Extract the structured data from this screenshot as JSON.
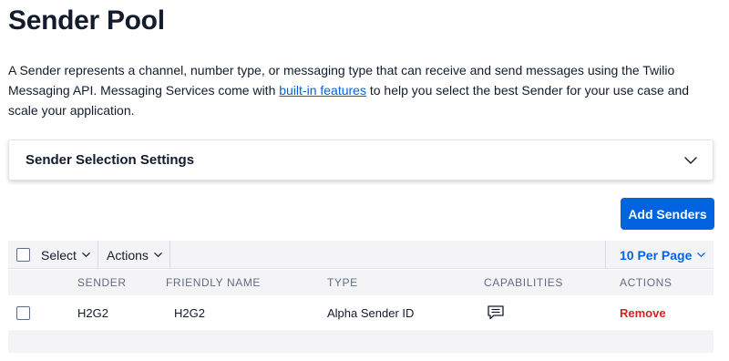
{
  "page": {
    "title": "Sender Pool",
    "intro_before": "A Sender represents a channel, number type, or messaging type that can receive and send messages using the Twilio Messaging API. Messaging Services come with ",
    "intro_link": "built-in features",
    "intro_after": " to help you select the best Sender for your use case and scale your application."
  },
  "settings": {
    "title": "Sender Selection Settings",
    "icon": "chevron-down-icon"
  },
  "add_button": {
    "label": "Add Senders"
  },
  "toolbar": {
    "select_label": "Select",
    "actions_label": "Actions",
    "per_page_label": "10 Per Page"
  },
  "table": {
    "headers": [
      "SENDER",
      "FRIENDLY NAME",
      "TYPE",
      "CAPABILITIES",
      "ACTIONS"
    ],
    "rows": [
      {
        "sender": "H2G2",
        "friendly_name": "H2G2",
        "type": "Alpha Sender ID",
        "capabilities_icon": "message-icon",
        "action": "Remove"
      }
    ]
  },
  "colors": {
    "primary": "#0263e0",
    "danger": "#d61f1f",
    "text": "#121c2d",
    "muted": "#606b85",
    "header_bg": "#f4f4f6"
  }
}
